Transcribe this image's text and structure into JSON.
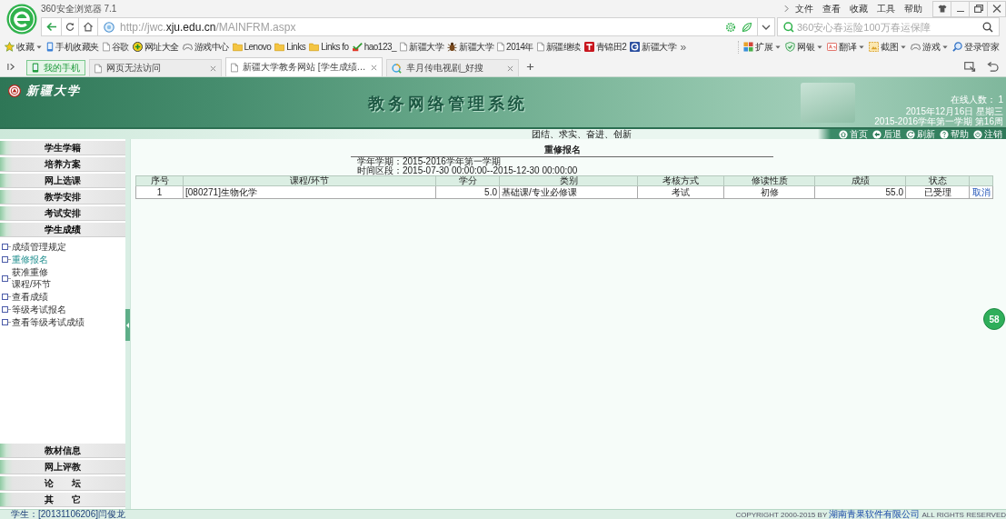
{
  "browser": {
    "title": "360安全浏览器 7.1",
    "menu": [
      "文件",
      "查看",
      "收藏",
      "工具",
      "帮助"
    ],
    "address": "http://jwc.**xju.edu.cn**/MAINFRM.aspx",
    "search": {
      "placeholder": "360安心春运险100万春运保障"
    },
    "bookmarks": [
      {
        "label": "收藏",
        "kind": "star",
        "dropdown": true
      },
      {
        "label": "手机收藏夹",
        "kind": "phone",
        "dropdown": false
      },
      {
        "label": "谷歌",
        "kind": "page",
        "dropdown": false
      },
      {
        "label": "网址大全",
        "kind": "plus",
        "dropdown": false
      },
      {
        "label": "游戏中心",
        "kind": "game",
        "dropdown": false
      },
      {
        "label": "Lenovo",
        "kind": "folder",
        "dropdown": false
      },
      {
        "label": "Links",
        "kind": "folder",
        "dropdown": false
      },
      {
        "label": "Links fo",
        "kind": "folder",
        "dropdown": false
      },
      {
        "label": "hao123_",
        "kind": "check",
        "dropdown": false
      },
      {
        "label": "新疆大学",
        "kind": "page",
        "dropdown": false
      },
      {
        "label": "新疆大学",
        "kind": "bug",
        "dropdown": false
      },
      {
        "label": "2014年",
        "kind": "page",
        "dropdown": false
      },
      {
        "label": "新疆继续",
        "kind": "page",
        "dropdown": false
      },
      {
        "label": "青锦田2",
        "kind": "tile",
        "dropdown": false
      },
      {
        "label": "新疆大学",
        "kind": "badge",
        "dropdown": false
      }
    ],
    "more": "»",
    "tools": [
      {
        "label": "扩展",
        "kind": "grid",
        "dropdown": true
      },
      {
        "label": "网银",
        "kind": "shield",
        "dropdown": true
      },
      {
        "label": "翻译",
        "kind": "translate",
        "dropdown": true
      },
      {
        "label": "截图",
        "kind": "crop",
        "dropdown": true
      },
      {
        "label": "游戏",
        "kind": "game",
        "dropdown": true
      },
      {
        "label": "登录管家",
        "kind": "login",
        "dropdown": false
      }
    ],
    "tabs": [
      {
        "label": "我的手机",
        "kind": "phone",
        "selected": false,
        "closable": false
      },
      {
        "label": "网页无法访问",
        "kind": "page",
        "selected": false,
        "closable": true
      },
      {
        "label": "新疆大学教务网站 [学生成绩…",
        "kind": "page",
        "selected": true,
        "closable": true
      },
      {
        "label": "芈月传电视剧_好搜",
        "kind": "search",
        "selected": false,
        "closable": true
      }
    ]
  },
  "page": {
    "header": {
      "logo": "新疆大学",
      "title": "教务网络管理系统",
      "online": "在线人数： 1",
      "date": "2015年12月16日 星期三",
      "term": "2015-2016学年第一学期 第16周",
      "slogan": "团结、求实、奋进、创新",
      "nav": [
        {
          "label": "首页",
          "kind": "home"
        },
        {
          "label": "后退",
          "kind": "back"
        },
        {
          "label": "刷新",
          "kind": "refresh"
        },
        {
          "label": "帮助",
          "kind": "help"
        },
        {
          "label": "注销",
          "kind": "logout"
        }
      ]
    },
    "sidebar": {
      "sections": [
        {
          "label": "学生学籍",
          "expanded": false
        },
        {
          "label": "培养方案",
          "expanded": false
        },
        {
          "label": "网上选课",
          "expanded": false
        },
        {
          "label": "教学安排",
          "expanded": false
        },
        {
          "label": "考试安排",
          "expanded": false
        },
        {
          "label": "学生成绩",
          "expanded": true,
          "children": [
            {
              "lines": [
                "成绩管理规定"
              ],
              "selected": false
            },
            {
              "lines": [
                "重修报名"
              ],
              "selected": true
            },
            {
              "lines": [
                "获准重修",
                "课程/环节"
              ],
              "selected": false
            },
            {
              "lines": [
                "查看成绩"
              ],
              "selected": false
            },
            {
              "lines": [
                "等级考试报名"
              ],
              "selected": false
            },
            {
              "lines": [
                "查看等级考试成绩"
              ],
              "selected": false
            }
          ]
        },
        {
          "label": "教材信息",
          "expanded": false
        },
        {
          "label": "网上评教",
          "expanded": false
        },
        {
          "label": "论　　坛",
          "expanded": false
        },
        {
          "label": "其　　它",
          "expanded": false
        }
      ]
    },
    "content": {
      "title": "重修报名",
      "term": "学年学期：2015-2016学年第一学期",
      "period": "时间区段：2015-07-30 00:00:00--2015-12-30 00:00:00",
      "table": {
        "columns": [
          "序号",
          "课程/环节",
          "学分",
          "类别",
          "考核方式",
          "修读性质",
          "成绩",
          "状态"
        ],
        "rows": [
          {
            "cells": [
              "1",
              "[080271]生物化学",
              "5.0",
              "基础课/专业必修课",
              "考试",
              "初修",
              "55.0",
              "已受理"
            ],
            "action": "取消"
          }
        ]
      }
    }
  },
  "floating_badge": "58",
  "status_bar": {
    "user": "学生：[20131106206]闫俊龙",
    "copyright": {
      "before": "COPYRIGHT 2000-2015 BY ",
      "link": "湖南青果软件有限公司",
      "after": " ALL RIGHTS RESERVED"
    }
  }
}
